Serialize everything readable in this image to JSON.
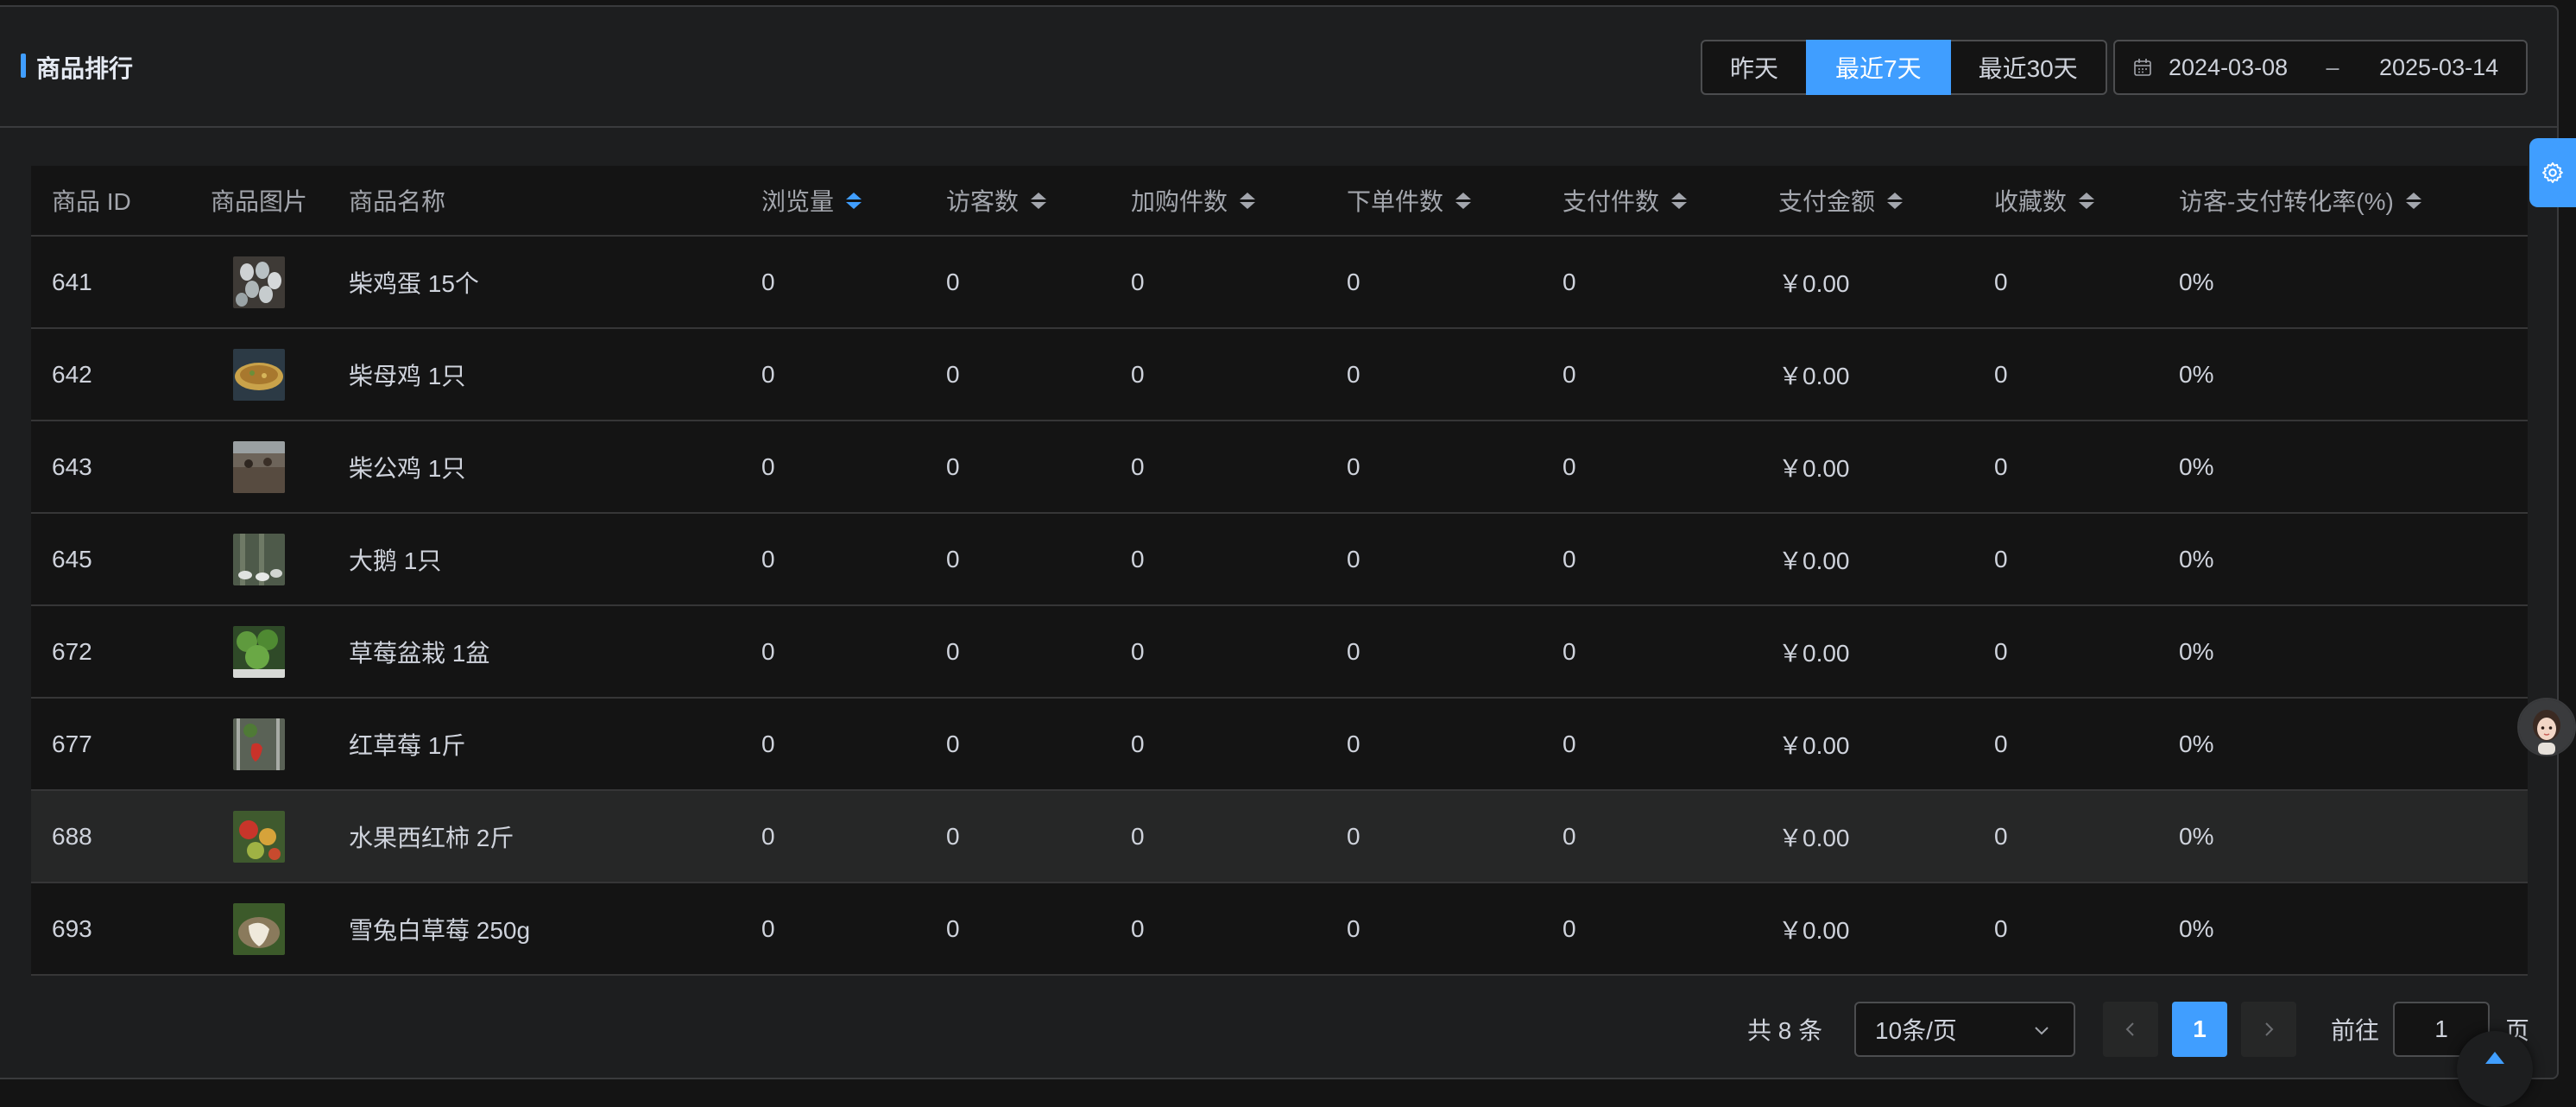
{
  "header": {
    "title": "商品排行",
    "ranges": [
      {
        "label": "昨天",
        "active": false
      },
      {
        "label": "最近7天",
        "active": true
      },
      {
        "label": "最近30天",
        "active": false
      }
    ],
    "date_start": "2024-03-08",
    "date_sep": "–",
    "date_end": "2025-03-14"
  },
  "table": {
    "columns": [
      "商品 ID",
      "商品图片",
      "商品名称",
      "浏览量",
      "访客数",
      "加购件数",
      "下单件数",
      "支付件数",
      "支付金额",
      "收藏数",
      "访客-支付转化率(%)"
    ],
    "sortable": [
      false,
      false,
      false,
      true,
      true,
      true,
      true,
      true,
      true,
      true,
      true
    ],
    "active_sort_column": "浏览量",
    "rows": [
      {
        "id": "641",
        "image": "eggs-photo",
        "name": "柴鸡蛋 15个",
        "views": "0",
        "visitors": "0",
        "cart": "0",
        "orders": "0",
        "paid": "0",
        "amount": "￥0.00",
        "favorites": "0",
        "conversion": "0%"
      },
      {
        "id": "642",
        "image": "hen-dish-photo",
        "name": "柴母鸡 1只",
        "views": "0",
        "visitors": "0",
        "cart": "0",
        "orders": "0",
        "paid": "0",
        "amount": "￥0.00",
        "favorites": "0",
        "conversion": "0%"
      },
      {
        "id": "643",
        "image": "rooster-farm-photo",
        "name": "柴公鸡 1只",
        "views": "0",
        "visitors": "0",
        "cart": "0",
        "orders": "0",
        "paid": "0",
        "amount": "￥0.00",
        "favorites": "0",
        "conversion": "0%"
      },
      {
        "id": "645",
        "image": "geese-photo",
        "name": "大鹅 1只",
        "views": "0",
        "visitors": "0",
        "cart": "0",
        "orders": "0",
        "paid": "0",
        "amount": "￥0.00",
        "favorites": "0",
        "conversion": "0%"
      },
      {
        "id": "672",
        "image": "strawberry-plant-photo",
        "name": "草莓盆栽 1盆",
        "views": "0",
        "visitors": "0",
        "cart": "0",
        "orders": "0",
        "paid": "0",
        "amount": "￥0.00",
        "favorites": "0",
        "conversion": "0%"
      },
      {
        "id": "677",
        "image": "red-strawberry-photo",
        "name": "红草莓 1斤",
        "views": "0",
        "visitors": "0",
        "cart": "0",
        "orders": "0",
        "paid": "0",
        "amount": "￥0.00",
        "favorites": "0",
        "conversion": "0%"
      },
      {
        "id": "688",
        "image": "tomato-photo",
        "name": "水果西红柿 2斤",
        "views": "0",
        "visitors": "0",
        "cart": "0",
        "orders": "0",
        "paid": "0",
        "amount": "￥0.00",
        "favorites": "0",
        "conversion": "0%"
      },
      {
        "id": "693",
        "image": "white-strawberry-photo",
        "name": "雪兔白草莓 250g",
        "views": "0",
        "visitors": "0",
        "cart": "0",
        "orders": "0",
        "paid": "0",
        "amount": "￥0.00",
        "favorites": "0",
        "conversion": "0%"
      }
    ]
  },
  "pagination": {
    "total_text": "共 8 条",
    "page_size": "10条/页",
    "current_page": "1",
    "goto_label": "前往",
    "goto_value": "1",
    "page_suffix": "页"
  },
  "colors": {
    "accent": "#409eff",
    "card_bg": "#1d1e1f",
    "table_bg": "#141414",
    "row_hover": "#262727",
    "border": "#363637"
  },
  "icons": {
    "calendar": "calendar-icon",
    "settings": "gear-icon",
    "prev": "chevron-left-icon",
    "next": "chevron-right-icon",
    "select": "chevron-down-icon",
    "back_top": "caret-up-icon",
    "assistant": "assistant-avatar"
  }
}
